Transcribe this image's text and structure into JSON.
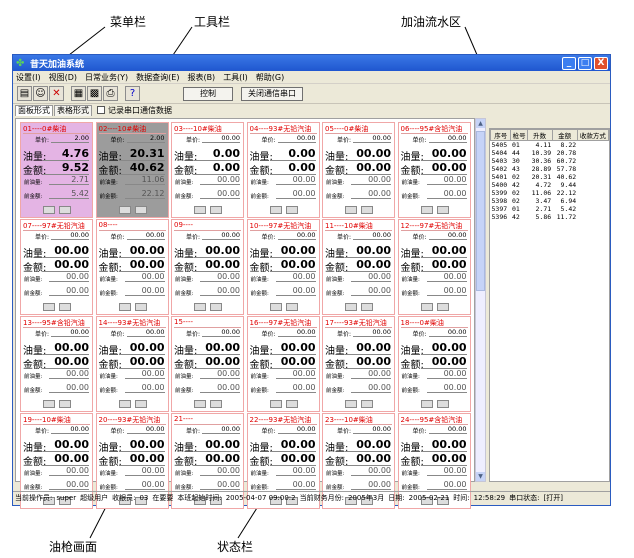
{
  "callouts": {
    "menubar": "菜单栏",
    "toolbar": "工具栏",
    "flow": "加油流水区",
    "pump": "油枪画面",
    "status": "状态栏"
  },
  "window": {
    "title": "昔天加油系统",
    "controls": [
      "_",
      "□",
      "X"
    ]
  },
  "menu": [
    "设置(I)",
    "视图(D)",
    "日常业务(Y)",
    "数据查询(E)",
    "报表(B)",
    "工具(I)",
    "帮助(G)"
  ],
  "toolbar": {
    "icons": [
      "card-icon",
      "people-icon",
      "delete-icon",
      "chart-icon",
      "save-icon",
      "print-icon",
      "help-icon"
    ],
    "icon_glyphs": [
      "▤",
      "☺",
      "✕",
      "▦",
      "▩",
      "⎙",
      "?"
    ],
    "control_label": "控制",
    "close_port_label": "关闭通信串口"
  },
  "tabs": {
    "panel_label": "面板形式",
    "table_label": "表格形式",
    "log_label": "记录串口通信数据"
  },
  "labels": {
    "unit_price": "单价:",
    "volume": "油量:",
    "amount": "金额:",
    "prev_volume": "前油量:",
    "prev_amount": "前金额:"
  },
  "pumps": [
    {
      "name": "01----0#柴油",
      "price": "2.00",
      "volume": "4.76",
      "amount": "9.52",
      "prev_volume": "2.71",
      "prev_amount": "5.42",
      "state": "pink"
    },
    {
      "name": "02----10#柴油",
      "price": "2.00",
      "volume": "20.31",
      "amount": "40.62",
      "prev_volume": "11.06",
      "prev_amount": "22.12",
      "state": "gray"
    },
    {
      "name": "03----10#柴油",
      "price": "00.00",
      "volume": "0.00",
      "amount": "0.00",
      "prev_volume": "00.00",
      "prev_amount": "00.00",
      "state": ""
    },
    {
      "name": "04----93#无铅汽油",
      "price": "00.00",
      "volume": "0.00",
      "amount": "0.00",
      "prev_volume": "00.00",
      "prev_amount": "00.00",
      "state": ""
    },
    {
      "name": "05----0#柴油",
      "price": "00.00",
      "volume": "00.00",
      "amount": "00.00",
      "prev_volume": "00.00",
      "prev_amount": "00.00",
      "state": ""
    },
    {
      "name": "06----95#含铅汽油",
      "price": "00.00",
      "volume": "00.00",
      "amount": "00.00",
      "prev_volume": "00.00",
      "prev_amount": "00.00",
      "state": ""
    },
    {
      "name": "07----97#无铅汽油",
      "price": "00.00",
      "volume": "00.00",
      "amount": "00.00",
      "prev_volume": "00.00",
      "prev_amount": "00.00",
      "state": ""
    },
    {
      "name": "08----",
      "price": "00.00",
      "volume": "00.00",
      "amount": "00.00",
      "prev_volume": "00.00",
      "prev_amount": "00.00",
      "state": ""
    },
    {
      "name": "09----",
      "price": "00.00",
      "volume": "00.00",
      "amount": "00.00",
      "prev_volume": "00.00",
      "prev_amount": "00.00",
      "state": ""
    },
    {
      "name": "10----97#无铅汽油",
      "price": "00.00",
      "volume": "00.00",
      "amount": "00.00",
      "prev_volume": "00.00",
      "prev_amount": "00.00",
      "state": ""
    },
    {
      "name": "11----10#柴油",
      "price": "00.00",
      "volume": "00.00",
      "amount": "00.00",
      "prev_volume": "00.00",
      "prev_amount": "00.00",
      "state": ""
    },
    {
      "name": "12----97#无铅汽油",
      "price": "00.00",
      "volume": "00.00",
      "amount": "00.00",
      "prev_volume": "00.00",
      "prev_amount": "00.00",
      "state": ""
    },
    {
      "name": "13----95#含铅汽油",
      "price": "00.00",
      "volume": "00.00",
      "amount": "00.00",
      "prev_volume": "00.00",
      "prev_amount": "00.00",
      "state": ""
    },
    {
      "name": "14----93#无铅汽油",
      "price": "00.00",
      "volume": "00.00",
      "amount": "00.00",
      "prev_volume": "00.00",
      "prev_amount": "00.00",
      "state": ""
    },
    {
      "name": "15----",
      "price": "00.00",
      "volume": "00.00",
      "amount": "00.00",
      "prev_volume": "00.00",
      "prev_amount": "00.00",
      "state": ""
    },
    {
      "name": "16----97#无铅汽油",
      "price": "00.00",
      "volume": "00.00",
      "amount": "00.00",
      "prev_volume": "00.00",
      "prev_amount": "00.00",
      "state": ""
    },
    {
      "name": "17----93#无铅汽油",
      "price": "00.00",
      "volume": "00.00",
      "amount": "00.00",
      "prev_volume": "00.00",
      "prev_amount": "00.00",
      "state": ""
    },
    {
      "name": "18----0#柴油",
      "price": "00.00",
      "volume": "00.00",
      "amount": "00.00",
      "prev_volume": "00.00",
      "prev_amount": "00.00",
      "state": ""
    },
    {
      "name": "19----10#柴油",
      "price": "00.00",
      "volume": "00.00",
      "amount": "00.00",
      "prev_volume": "00.00",
      "prev_amount": "00.00",
      "state": ""
    },
    {
      "name": "20----93#无铅汽油",
      "price": "00.00",
      "volume": "00.00",
      "amount": "00.00",
      "prev_volume": "00.00",
      "prev_amount": "00.00",
      "state": ""
    },
    {
      "name": "21----",
      "price": "00.00",
      "volume": "00.00",
      "amount": "00.00",
      "prev_volume": "00.00",
      "prev_amount": "00.00",
      "state": ""
    },
    {
      "name": "22----93#无铅汽油",
      "price": "00.00",
      "volume": "00.00",
      "amount": "00.00",
      "prev_volume": "00.00",
      "prev_amount": "00.00",
      "state": ""
    },
    {
      "name": "23----10#柴油",
      "price": "00.00",
      "volume": "00.00",
      "amount": "00.00",
      "prev_volume": "00.00",
      "prev_amount": "00.00",
      "state": ""
    },
    {
      "name": "24----95#含铅汽油",
      "price": "00.00",
      "volume": "00.00",
      "amount": "00.00",
      "prev_volume": "00.00",
      "prev_amount": "00.00",
      "state": ""
    }
  ],
  "flow": {
    "columns": [
      "序号",
      "枪号",
      "升数",
      "金额",
      "收款方式"
    ],
    "rows": [
      [
        "5405",
        "01",
        "4.11",
        "8.22"
      ],
      [
        "5404",
        "44",
        "10.39",
        "20.78"
      ],
      [
        "5403",
        "30",
        "30.36",
        "60.72"
      ],
      [
        "5402",
        "43",
        "28.89",
        "57.78"
      ],
      [
        "5401",
        "02",
        "20.31",
        "40.62"
      ],
      [
        "5400",
        "42",
        "4.72",
        "9.44"
      ],
      [
        "5399",
        "02",
        "11.06",
        "22.12"
      ],
      [
        "5398",
        "02",
        "3.47",
        "6.94"
      ],
      [
        "5397",
        "01",
        "2.71",
        "5.42"
      ],
      [
        "5396",
        "42",
        "5.86",
        "11.72"
      ]
    ]
  },
  "status": {
    "operator_label": "当前操作员:",
    "operator": "super",
    "role": "超级用户",
    "cashier_label": "收银员:",
    "cashier": "03",
    "on_duty": "在要要",
    "shift_start_label": "本班起始时间:",
    "shift_start": "2005-04-07 09:00:2",
    "month_label": "当前财务月份:",
    "month": "2005年3月",
    "date_label": "日期:",
    "date": "2005-02-21",
    "time_label": "时间:",
    "time": "12:58:29",
    "port_label": "串口状态:",
    "port": "[打开]"
  }
}
